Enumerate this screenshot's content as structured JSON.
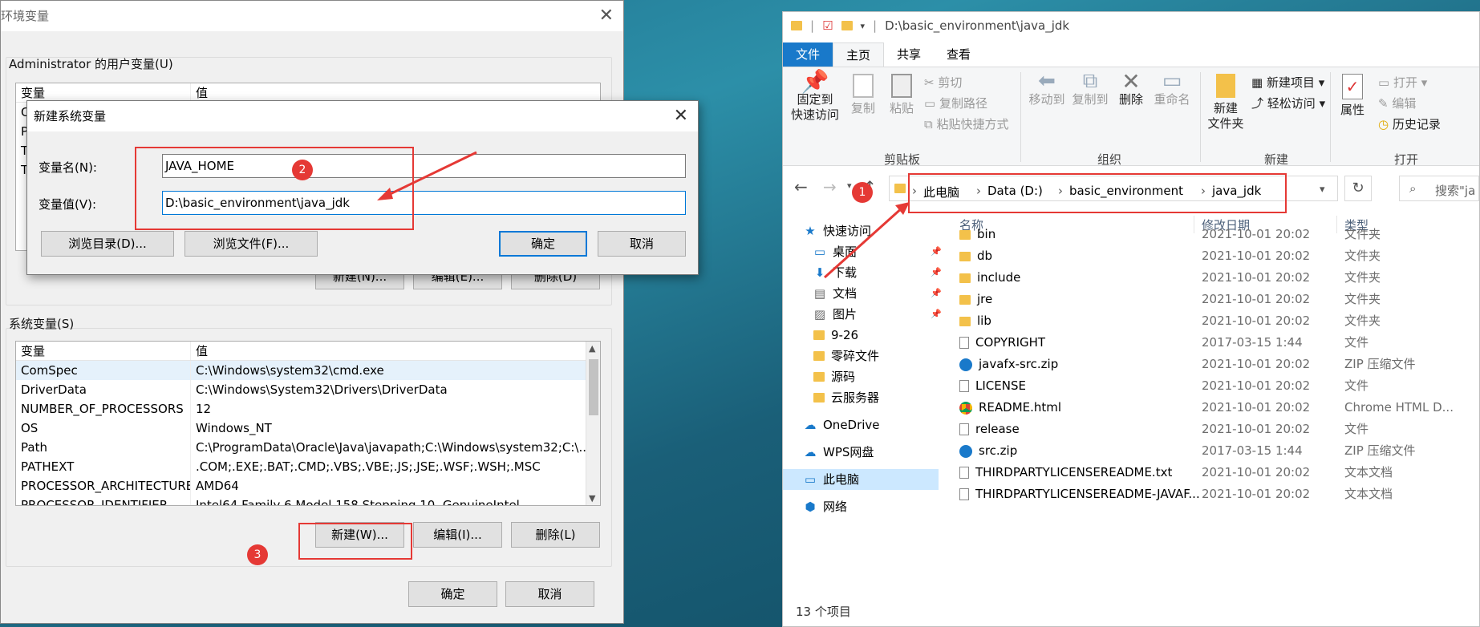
{
  "env_dialog": {
    "title": "环境变量",
    "user_group_label": "Administrator 的用户变量(U)",
    "user_headers": [
      "变量",
      "值"
    ],
    "user_rows": [
      {
        "name": "C",
        "value": ""
      },
      {
        "name": "P",
        "value": ""
      },
      {
        "name": "T",
        "value": ""
      },
      {
        "name": "T",
        "value": ""
      }
    ],
    "user_buttons": [
      "新建(N)...",
      "编辑(E)...",
      "删除(D)"
    ],
    "sys_group_label": "系统变量(S)",
    "sys_headers": [
      "变量",
      "值"
    ],
    "sys_rows": [
      {
        "name": "ComSpec",
        "value": "C:\\Windows\\system32\\cmd.exe"
      },
      {
        "name": "DriverData",
        "value": "C:\\Windows\\System32\\Drivers\\DriverData"
      },
      {
        "name": "NUMBER_OF_PROCESSORS",
        "value": "12"
      },
      {
        "name": "OS",
        "value": "Windows_NT"
      },
      {
        "name": "Path",
        "value": "C:\\ProgramData\\Oracle\\Java\\javapath;C:\\Windows\\system32;C:\\..."
      },
      {
        "name": "PATHEXT",
        "value": ".COM;.EXE;.BAT;.CMD;.VBS;.VBE;.JS;.JSE;.WSF;.WSH;.MSC"
      },
      {
        "name": "PROCESSOR_ARCHITECTURE",
        "value": "AMD64"
      },
      {
        "name": "PROCESSOR_IDENTIFIER",
        "value": "Intel64 Family 6 Model 158 Stepping 10, GenuineIntel"
      }
    ],
    "sys_buttons": [
      "新建(W)...",
      "编辑(I)...",
      "删除(L)"
    ],
    "ok": "确定",
    "cancel": "取消"
  },
  "new_var_dialog": {
    "title": "新建系统变量",
    "name_label": "变量名(N):",
    "name_value": "JAVA_HOME",
    "value_label": "变量值(V):",
    "value_value": "D:\\basic_environment\\java_jdk",
    "browse_dir": "浏览目录(D)...",
    "browse_file": "浏览文件(F)...",
    "ok": "确定",
    "cancel": "取消"
  },
  "explorer": {
    "title_path": "D:\\basic_environment\\java_jdk",
    "tabs": [
      "文件",
      "主页",
      "共享",
      "查看"
    ],
    "ribbon": {
      "pin": "固定到\n快速访问",
      "copy": "复制",
      "paste": "粘贴",
      "cut": "剪切",
      "copy_path": "复制路径",
      "paste_shortcut": "粘贴快捷方式",
      "clipboard_group": "剪贴板",
      "move_to": "移动到",
      "copy_to": "复制到",
      "delete": "删除",
      "rename": "重命名",
      "organize_group": "组织",
      "new_folder": "新建\n文件夹",
      "new_item": "新建项目",
      "easy_access": "轻松访问",
      "new_group": "新建",
      "properties": "属性",
      "open": "打开",
      "edit": "编辑",
      "history": "历史记录",
      "open_group": "打开"
    },
    "breadcrumb": [
      "此电脑",
      "Data (D:)",
      "basic_environment",
      "java_jdk"
    ],
    "search_placeholder": "搜索\"ja",
    "nav": [
      {
        "label": "快速访问",
        "icon": "star-icon"
      },
      {
        "label": "桌面",
        "icon": "desktop-icon"
      },
      {
        "label": "下载",
        "icon": "download-icon"
      },
      {
        "label": "文档",
        "icon": "document-icon"
      },
      {
        "label": "图片",
        "icon": "picture-icon"
      },
      {
        "label": "9-26",
        "icon": "folder-icon"
      },
      {
        "label": "零碎文件",
        "icon": "folder-icon"
      },
      {
        "label": "源码",
        "icon": "folder-icon"
      },
      {
        "label": "云服务器",
        "icon": "folder-icon"
      },
      {
        "label": "OneDrive",
        "icon": "cloud-icon"
      },
      {
        "label": "WPS网盘",
        "icon": "cloud-icon"
      },
      {
        "label": "此电脑",
        "icon": "computer-icon"
      },
      {
        "label": "网络",
        "icon": "network-icon"
      }
    ],
    "columns": [
      "名称",
      "修改日期",
      "类型"
    ],
    "files": [
      {
        "name": "bin",
        "date": "2021-10-01 20:02",
        "type": "文件夹",
        "icon": "folder"
      },
      {
        "name": "db",
        "date": "2021-10-01 20:02",
        "type": "文件夹",
        "icon": "folder"
      },
      {
        "name": "include",
        "date": "2021-10-01 20:02",
        "type": "文件夹",
        "icon": "folder"
      },
      {
        "name": "jre",
        "date": "2021-10-01 20:02",
        "type": "文件夹",
        "icon": "folder"
      },
      {
        "name": "lib",
        "date": "2021-10-01 20:02",
        "type": "文件夹",
        "icon": "folder"
      },
      {
        "name": "COPYRIGHT",
        "date": "2017-03-15 1:44",
        "type": "文件",
        "icon": "doc"
      },
      {
        "name": "javafx-src.zip",
        "date": "2021-10-01 20:02",
        "type": "ZIP 压缩文件",
        "icon": "zip"
      },
      {
        "name": "LICENSE",
        "date": "2021-10-01 20:02",
        "type": "文件",
        "icon": "doc"
      },
      {
        "name": "README.html",
        "date": "2021-10-01 20:02",
        "type": "Chrome HTML D...",
        "icon": "chrome"
      },
      {
        "name": "release",
        "date": "2021-10-01 20:02",
        "type": "文件",
        "icon": "doc"
      },
      {
        "name": "src.zip",
        "date": "2017-03-15 1:44",
        "type": "ZIP 压缩文件",
        "icon": "zip"
      },
      {
        "name": "THIRDPARTYLICENSEREADME.txt",
        "date": "2021-10-01 20:02",
        "type": "文本文档",
        "icon": "txt"
      },
      {
        "name": "THIRDPARTYLICENSEREADME-JAVAF...",
        "date": "2021-10-01 20:02",
        "type": "文本文档",
        "icon": "txt"
      }
    ],
    "status": "13 个项目"
  },
  "annotations": [
    "1",
    "2",
    "3"
  ],
  "colors": {
    "accent": "#0078d7",
    "annotation_red": "#e53935",
    "file_tab": "#1979ca"
  }
}
